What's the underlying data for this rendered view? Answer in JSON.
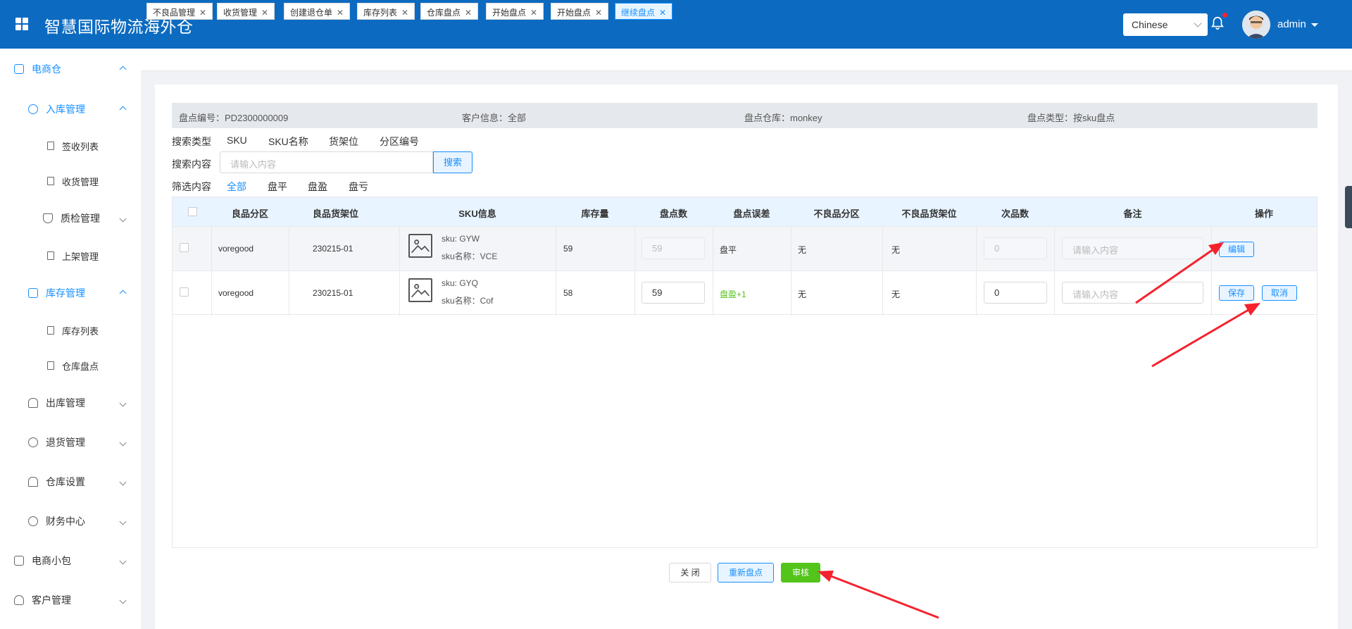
{
  "header": {
    "title": "智慧国际物流海外仓",
    "language": "Chinese",
    "user": "admin"
  },
  "sidebar": {
    "items": [
      {
        "label": "电商仓"
      },
      {
        "label": "入库管理"
      },
      {
        "label": "签收列表"
      },
      {
        "label": "收货管理"
      },
      {
        "label": "质检管理"
      },
      {
        "label": "上架管理"
      },
      {
        "label": "库存管理"
      },
      {
        "label": "库存列表"
      },
      {
        "label": "仓库盘点"
      },
      {
        "label": "出库管理"
      },
      {
        "label": "退货管理"
      },
      {
        "label": "仓库设置"
      },
      {
        "label": "财务中心"
      },
      {
        "label": "电商小包"
      },
      {
        "label": "客户管理"
      }
    ]
  },
  "tabs": [
    "不良品管理",
    "收货管理",
    "创建退仓单",
    "库存列表",
    "仓库盘点",
    "开始盘点",
    "开始盘点",
    "继续盘点"
  ],
  "info": {
    "code": "盘点编号：PD2300000009",
    "customer": "客户信息：全部",
    "warehouse": "盘点仓库：monkey",
    "type": "盘点类型：按sku盘点"
  },
  "search": {
    "type_label": "搜索类型",
    "type_options": [
      "SKU",
      "SKU名称",
      "货架位",
      "分区编号"
    ],
    "content_label": "搜索内容",
    "placeholder": "请输入内容",
    "button": "搜索",
    "filter_label": "筛选内容",
    "filter_options": [
      "全部",
      "盘平",
      "盘盈",
      "盘亏"
    ]
  },
  "table": {
    "headers": [
      "良品分区",
      "良品货架位",
      "SKU信息",
      "库存量",
      "盘点数",
      "盘点误差",
      "不良品分区",
      "不良品货架位",
      "次品数",
      "备注",
      "操作"
    ],
    "rows": [
      {
        "zone": "voregood",
        "shelf": "230215-01",
        "sku": "sku: GYW",
        "sku_name": "sku名称：VCE",
        "stock": "59",
        "count": "59",
        "diff": "盘平",
        "bad_zone": "无",
        "bad_shelf": "无",
        "defect": "0",
        "remark_ph": "请输入内容",
        "actions": [
          "编辑"
        ]
      },
      {
        "zone": "voregood",
        "shelf": "230215-01",
        "sku": "sku: GYQ",
        "sku_name": "sku名称：Cof",
        "stock": "58",
        "count": "59",
        "diff": "盘盈+1",
        "bad_zone": "无",
        "bad_shelf": "无",
        "defect": "0",
        "remark_ph": "请输入内容",
        "actions": [
          "保存",
          "取消"
        ]
      }
    ]
  },
  "footer": {
    "close": "关 闭",
    "recount": "重新盘点",
    "review": "审核"
  },
  "colors": {
    "header": "#0c6bc1",
    "accent": "#1890ff",
    "success": "#52c41a",
    "arrow": "#f5222d"
  }
}
